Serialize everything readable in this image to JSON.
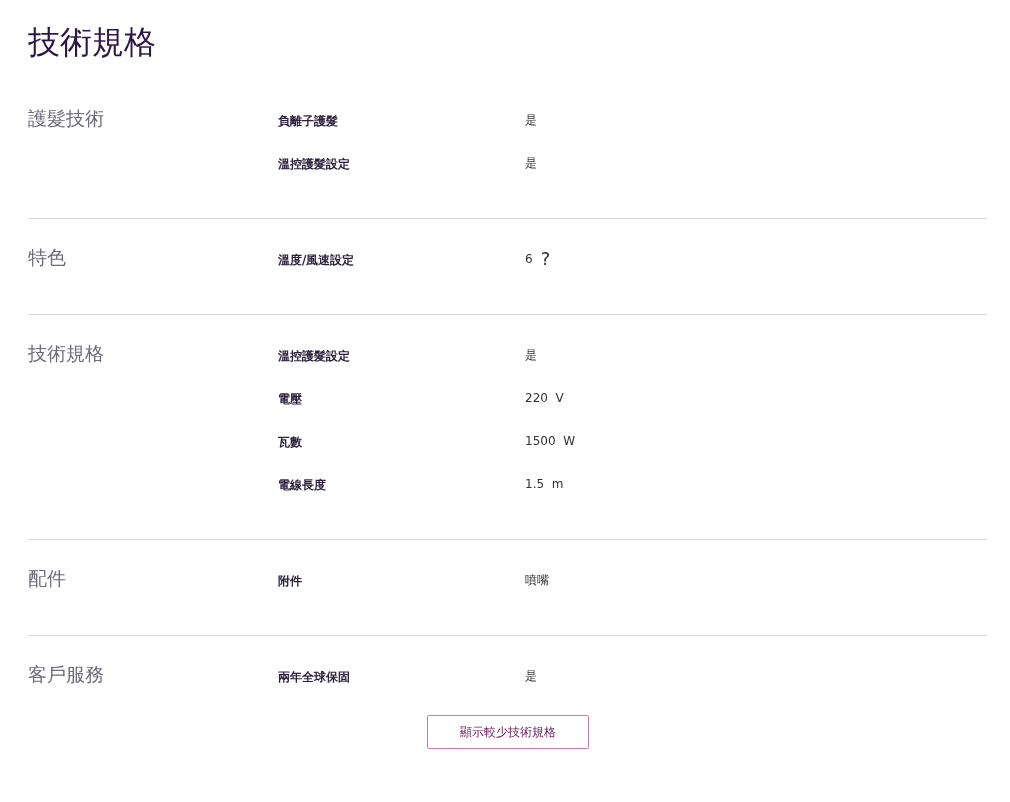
{
  "title": "技術規格",
  "sections": [
    {
      "category": "護髮技術",
      "rows": [
        {
          "label": "負離子護髮",
          "value": "是"
        },
        {
          "label": "溫控護髮設定",
          "value": "是"
        }
      ]
    },
    {
      "category": "特色",
      "rows": [
        {
          "label": "溫度/風速設定",
          "value": "6",
          "help": "?"
        }
      ]
    },
    {
      "category": "技術規格",
      "rows": [
        {
          "label": "溫控護髮設定",
          "value": "是"
        },
        {
          "label": "電壓",
          "value": "220  V"
        },
        {
          "label": "瓦數",
          "value": "1500  W"
        },
        {
          "label": "電線長度",
          "value": "1.5  m"
        }
      ]
    },
    {
      "category": "配件",
      "rows": [
        {
          "label": "附件",
          "value": "噴嘴"
        }
      ]
    },
    {
      "category": "客戶服務",
      "rows": [
        {
          "label": "兩年全球保固",
          "value": "是"
        }
      ]
    }
  ],
  "button": "顯示較少技術規格"
}
